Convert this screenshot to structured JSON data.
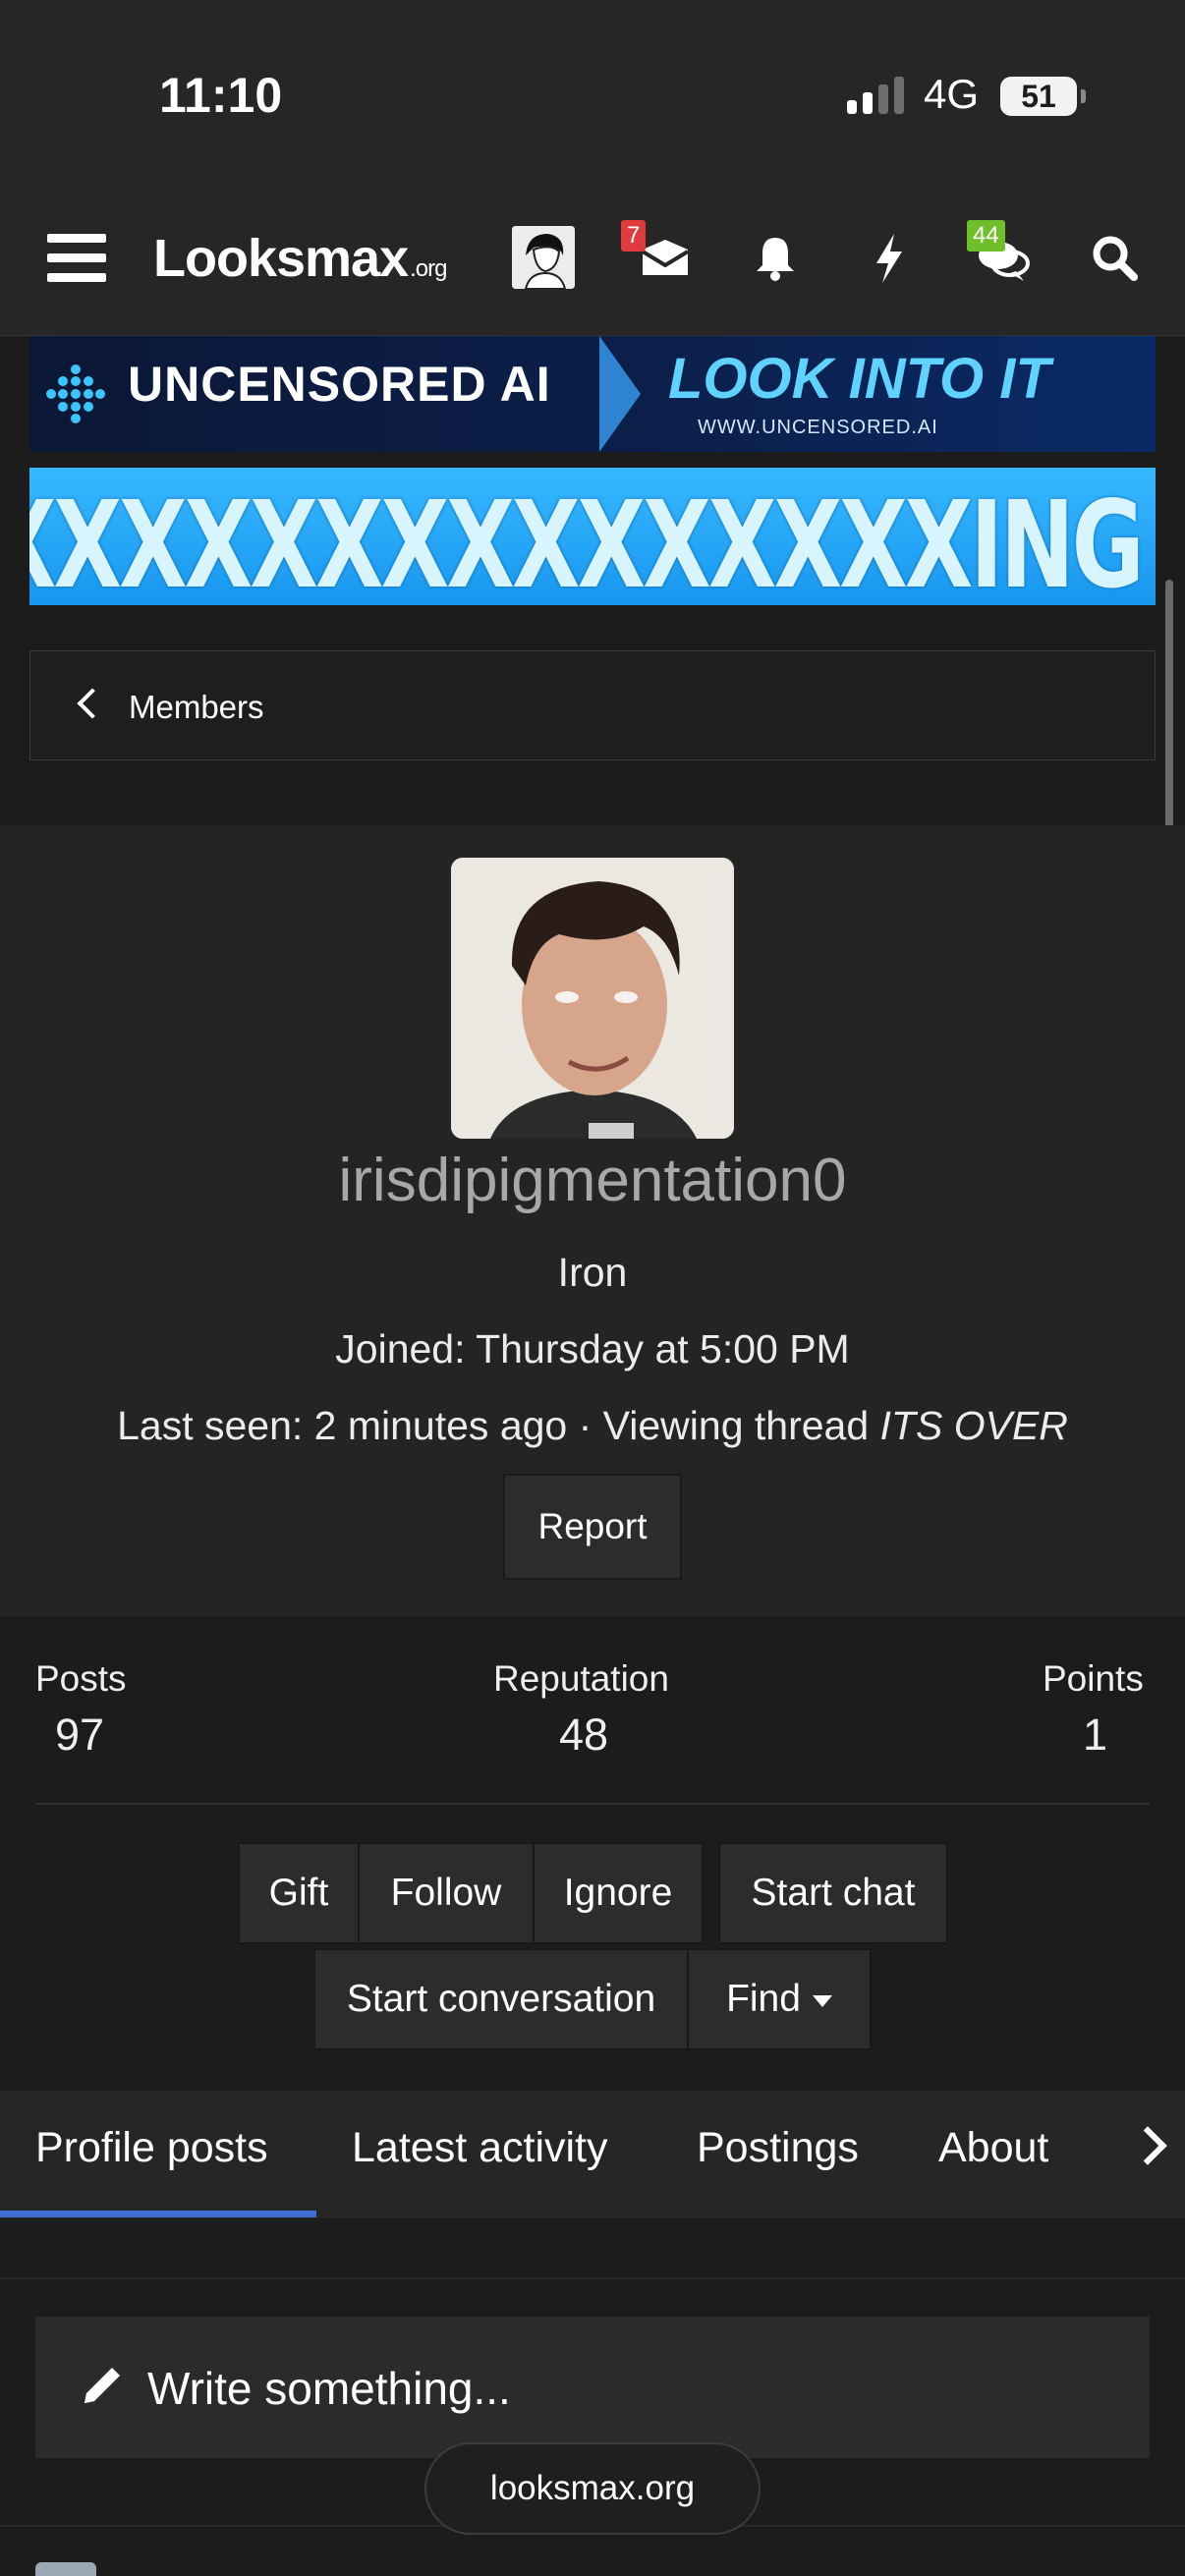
{
  "status_bar": {
    "time": "11:10",
    "network": "4G",
    "battery": "51"
  },
  "nav": {
    "logo_main": "Looksmax",
    "logo_suffix": ".org",
    "inbox_badge": "7",
    "chat_badge": "44",
    "colors": {
      "inbox_badge": "#e0393e",
      "chat_badge": "#6fbf2a"
    }
  },
  "ads": {
    "ad1_left": "UNCENSORED AI",
    "ad1_right": "LOOK INTO IT",
    "ad1_url": "WWW.UNCENSORED.AI",
    "ad2_text": "XXXXXXXXXXXXXXXXXXING"
  },
  "breadcrumb": {
    "label": "Members"
  },
  "profile": {
    "username": "irisdipigmentation0",
    "rank": "Iron",
    "joined": "Joined: Thursday at 5:00 PM",
    "last_seen_prefix": "Last seen: 2 minutes ago · Viewing thread ",
    "last_seen_thread": "ITS OVER",
    "report_label": "Report"
  },
  "stats": {
    "posts_label": "Posts",
    "posts_value": "97",
    "reputation_label": "Reputation",
    "reputation_value": "48",
    "points_label": "Points",
    "points_value": "1"
  },
  "actions": {
    "gift": "Gift",
    "follow": "Follow",
    "ignore": "Ignore",
    "start_chat": "Start chat",
    "start_conversation": "Start conversation",
    "find": "Find"
  },
  "tabs": {
    "profile_posts": "Profile posts",
    "latest_activity": "Latest activity",
    "postings": "Postings",
    "about": "About"
  },
  "composer": {
    "placeholder": "Write something..."
  },
  "domain_pill": "looksmax.org"
}
